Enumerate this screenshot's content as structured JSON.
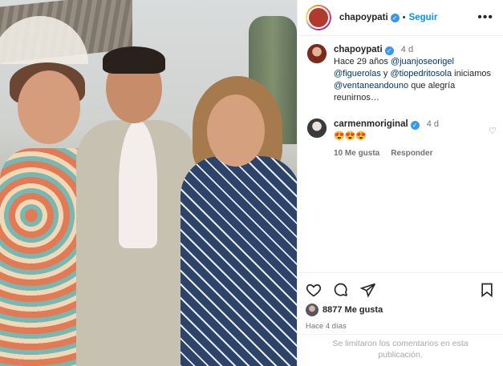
{
  "header": {
    "username": "chapoypati",
    "separator": "•",
    "follow_label": "Seguir",
    "more_icon": "more-horizontal-icon"
  },
  "caption": {
    "username": "chapoypati",
    "time": "4 d",
    "text_1": "Hace 29 años ",
    "mention_1": "@juanjoseorigel",
    "mention_2": "@figuerolas",
    "text_2": " y ",
    "mention_3": "@tiopedritosola",
    "text_3": " iniciamos",
    "mention_4": "@ventaneandouno",
    "text_4": " que alegría reunirnos…"
  },
  "comment": {
    "username": "carmenmoriginal",
    "time": "4 d",
    "text": "😍😍😍",
    "likes": "10 Me gusta",
    "reply_label": "Responder"
  },
  "actions": {
    "likes_count": "8877 Me gusta",
    "posted_ago": "Hace 4 días"
  },
  "footer": {
    "notice": "Se limitaron los comentarios en esta publicación."
  },
  "colors": {
    "accent": "#0095f6",
    "verified": "#3897f0",
    "muted": "#737373"
  }
}
